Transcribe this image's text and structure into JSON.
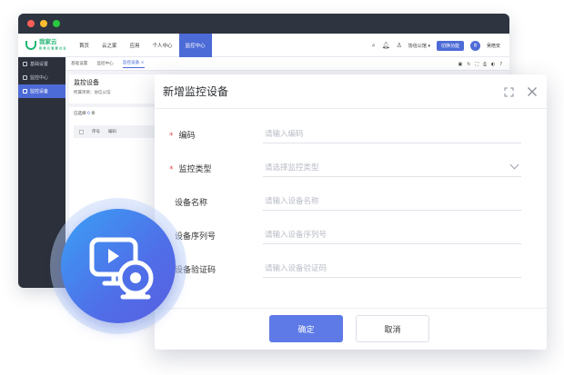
{
  "colors": {
    "accent": "#4d6bd7",
    "required": "#e05050",
    "sidebar": "#2b303b",
    "brand_green": "#22b573"
  },
  "window": {
    "traffic_lights": [
      "#ff5f57",
      "#febc2e",
      "#28c840"
    ]
  },
  "app": {
    "logo_text": "我家云",
    "logo_sub": "我 家 云 智 能 社 区",
    "nav": [
      "首页",
      "云之家",
      "应用",
      "个人中心",
      "监控中心"
    ],
    "org": "协信公馆 ▾",
    "quick_button": "切换功能",
    "avatar_text": "皆",
    "user_name": "吴皓安"
  },
  "sidebar": {
    "items": [
      {
        "label": "基础设置"
      },
      {
        "label": "监控中心"
      },
      {
        "label": "监控设备"
      }
    ]
  },
  "tabs": [
    "基础设置",
    "监控中心",
    "监控设备"
  ],
  "page": {
    "title": "监控设备",
    "project_label": "所属项目：协信公馆",
    "selected_prefix": "已选择",
    "selected_count": "0",
    "selected_suffix": "条",
    "columns": [
      "序号",
      "编码"
    ]
  },
  "modal": {
    "title": "新增监控设备",
    "fields": [
      {
        "label": "编码",
        "required": true,
        "placeholder": "请输入编码"
      },
      {
        "label": "监控类型",
        "required": true,
        "placeholder": "请选择监控类型",
        "select": true
      },
      {
        "label": "设备名称",
        "required": false,
        "placeholder": "请输入设备名称"
      },
      {
        "label": "设备序列号",
        "required": false,
        "placeholder": "请输入设备序列号"
      },
      {
        "label": "设备验证码",
        "required": false,
        "placeholder": "请输入设备验证码"
      }
    ],
    "ok": "确定",
    "cancel": "取消"
  },
  "icons": {
    "badge": "monitor-camera-icon",
    "expand": "expand-icon",
    "close": "close-icon"
  }
}
